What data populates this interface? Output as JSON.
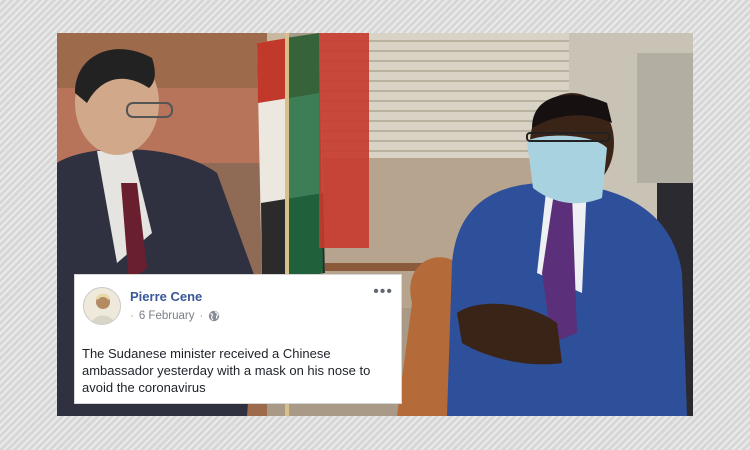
{
  "post": {
    "author": "Pierre Cene",
    "date": "6 February",
    "separator": "·",
    "privacy_icon": "globe-icon",
    "menu_icon": "more-options-icon",
    "menu_glyph": "•••",
    "text": "The Sudanese minister received a Chinese ambassador yesterday with a mask on his nose to avoid the coronavirus"
  },
  "colors": {
    "author_link": "#385898",
    "meta_text": "#7a7f87",
    "body_text": "#1d2129"
  }
}
